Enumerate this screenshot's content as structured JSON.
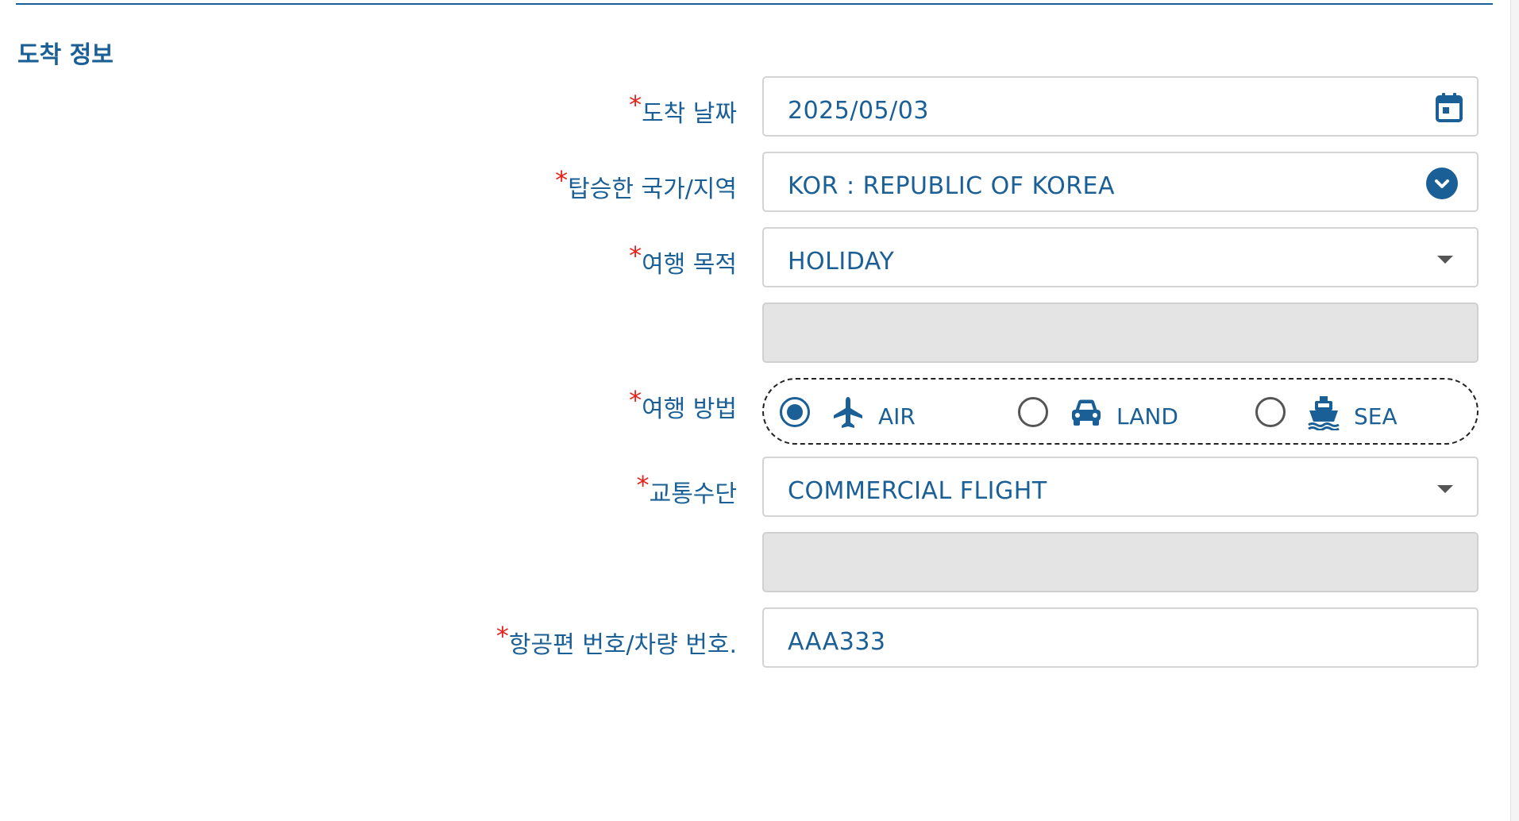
{
  "section": {
    "title": "도착 정보"
  },
  "required_mark": "*",
  "fields": {
    "arrival_date": {
      "label": "도착 날짜",
      "value": "2025/05/03",
      "icon": "calendar-icon"
    },
    "boarding_country": {
      "label": "탑승한 국가/지역",
      "value": "KOR : REPUBLIC OF KOREA",
      "icon": "chevron-down-circle-icon"
    },
    "travel_purpose": {
      "label": "여행 목적",
      "value": "HOLIDAY",
      "icon": "caret-down-icon"
    },
    "travel_purpose_other": {
      "value": ""
    },
    "travel_mode": {
      "label": "여행 방법",
      "options": [
        {
          "label": "AIR",
          "icon": "airplane-icon",
          "selected": true
        },
        {
          "label": "LAND",
          "icon": "car-icon",
          "selected": false
        },
        {
          "label": "SEA",
          "icon": "ship-icon",
          "selected": false
        }
      ]
    },
    "transport": {
      "label": "교통수단",
      "value": "COMMERCIAL FLIGHT",
      "icon": "caret-down-icon"
    },
    "transport_other": {
      "value": ""
    },
    "flight_number": {
      "label": "항공편 번호/차량 번호.",
      "value": "AAA333"
    }
  },
  "colors": {
    "primary": "#1a5f96",
    "required": "#e8221b",
    "border": "#d4d4d4",
    "disabled": "#e4e4e4"
  }
}
